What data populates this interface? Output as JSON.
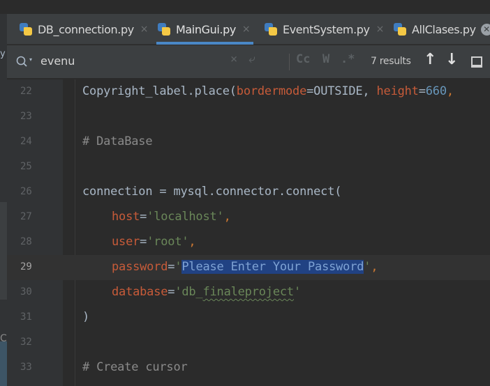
{
  "tabs": [
    {
      "label": "DB_connection.py",
      "close": "×",
      "active": false
    },
    {
      "label": "MainGui.py",
      "close": "×",
      "active": true
    },
    {
      "label": "EventSystem.py",
      "close": "×",
      "active": false
    },
    {
      "label": "AllClases.py",
      "close": "✕",
      "active": false
    }
  ],
  "left_gutter_glyph": "y",
  "left_gutter_glyph2": "C",
  "search": {
    "query": "evenu",
    "caret": "▾",
    "clear": "×",
    "wrap": "⤶",
    "match_case": "Cc",
    "words": "W",
    "regex": ".*",
    "results": "7 results",
    "prev": "↑",
    "next": "↓"
  },
  "editor": {
    "current_line": "29",
    "lines": [
      {
        "num": "22"
      },
      {
        "num": "23"
      },
      {
        "num": "24"
      },
      {
        "num": "25"
      },
      {
        "num": "26"
      },
      {
        "num": "27"
      },
      {
        "num": "28"
      },
      {
        "num": "29"
      },
      {
        "num": "30"
      },
      {
        "num": "31"
      },
      {
        "num": "32"
      },
      {
        "num": "33"
      }
    ],
    "code": {
      "l22_a": "Copyright_label.place(",
      "l22_b": "bordermode",
      "l22_c": "=OUTSIDE, ",
      "l22_d": "height",
      "l22_e": "=",
      "l22_f": "660",
      "l22_g": ",",
      "l24": "# DataBase",
      "l26": "connection = mysql.connector.connect(",
      "l27_a": "host",
      "l27_b": "=",
      "l27_c": "'localhost'",
      "l27_d": ",",
      "l28_a": "user",
      "l28_b": "=",
      "l28_c": "'root'",
      "l28_d": ",",
      "l29_a": "password",
      "l29_b": "=",
      "l29_c": "'",
      "l29_d": "Please Enter Your Password",
      "l29_e": "'",
      "l29_f": ",",
      "l30_a": "database",
      "l30_b": "=",
      "l30_c": "'db_",
      "l30_d": "finaleproject",
      "l30_e": "'",
      "l31": ")",
      "l33": "# Create cursor"
    }
  },
  "colors": {
    "background": "#2b2b2b",
    "keyword_param": "#cc7832",
    "string": "#6a8759",
    "number": "#6897bb",
    "selection": "#214283",
    "accent": "#4a88c7"
  }
}
